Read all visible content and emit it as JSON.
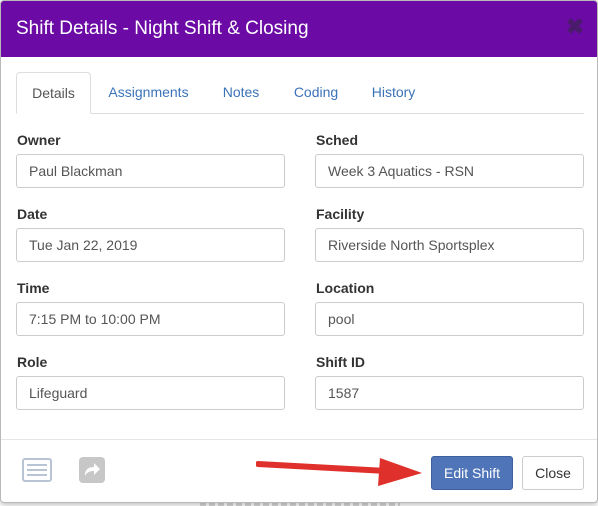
{
  "dialog": {
    "title": "Shift Details - Night Shift & Closing",
    "close_glyph": "✖",
    "header_color": "#6c0aa6"
  },
  "tabs": [
    {
      "label": "Details",
      "active": true
    },
    {
      "label": "Assignments",
      "active": false
    },
    {
      "label": "Notes",
      "active": false
    },
    {
      "label": "Coding",
      "active": false
    },
    {
      "label": "History",
      "active": false
    }
  ],
  "fields": {
    "owner": {
      "label": "Owner",
      "value": "Paul Blackman"
    },
    "sched": {
      "label": "Sched",
      "value": "Week 3 Aquatics - RSN"
    },
    "date": {
      "label": "Date",
      "value": "Tue Jan 22, 2019"
    },
    "facility": {
      "label": "Facility",
      "value": "Riverside North Sportsplex"
    },
    "time": {
      "label": "Time",
      "value": "7:15 PM to 10:00 PM"
    },
    "location": {
      "label": "Location",
      "value": "pool"
    },
    "role": {
      "label": "Role",
      "value": "Lifeguard"
    },
    "shift_id": {
      "label": "Shift ID",
      "value": "1587"
    }
  },
  "footer": {
    "icons": [
      "list-icon",
      "share-arrow-icon"
    ],
    "edit_label": "Edit Shift",
    "close_label": "Close",
    "primary_color": "#4f74b8",
    "arrow_color": "#e0302b"
  }
}
